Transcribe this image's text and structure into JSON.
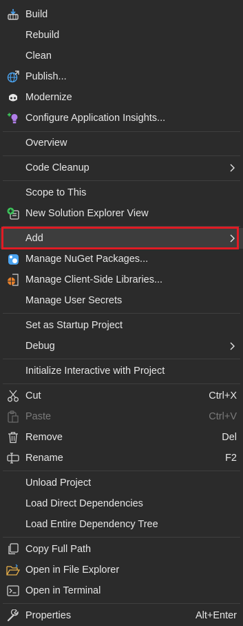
{
  "menu": {
    "items": [
      {
        "label": "Build",
        "icon": "build-icon"
      },
      {
        "label": "Rebuild"
      },
      {
        "label": "Clean"
      },
      {
        "label": "Publish...",
        "icon": "publish-globe-icon"
      },
      {
        "label": "Modernize",
        "icon": "copilot-icon"
      },
      {
        "label": "Configure Application Insights...",
        "icon": "app-insights-icon"
      },
      {
        "label": "Overview"
      },
      {
        "label": "Code Cleanup",
        "submenu": true
      },
      {
        "label": "Scope to This"
      },
      {
        "label": "New Solution Explorer View",
        "icon": "new-view-icon"
      },
      {
        "label": "Add",
        "submenu": true,
        "highlighted": true
      },
      {
        "label": "Manage NuGet Packages...",
        "icon": "nuget-icon"
      },
      {
        "label": "Manage Client-Side Libraries...",
        "icon": "libman-icon"
      },
      {
        "label": "Manage User Secrets"
      },
      {
        "label": "Set as Startup Project"
      },
      {
        "label": "Debug",
        "submenu": true
      },
      {
        "label": "Initialize Interactive with Project"
      },
      {
        "label": "Cut",
        "shortcut": "Ctrl+X",
        "icon": "scissors-icon"
      },
      {
        "label": "Paste",
        "shortcut": "Ctrl+V",
        "icon": "clipboard-icon",
        "disabled": true
      },
      {
        "label": "Remove",
        "shortcut": "Del",
        "icon": "trash-icon"
      },
      {
        "label": "Rename",
        "shortcut": "F2",
        "icon": "rename-icon"
      },
      {
        "label": "Unload Project"
      },
      {
        "label": "Load Direct Dependencies"
      },
      {
        "label": "Load Entire Dependency Tree"
      },
      {
        "label": "Copy Full Path",
        "icon": "copy-icon"
      },
      {
        "label": "Open in File Explorer",
        "icon": "folder-open-icon"
      },
      {
        "label": "Open in Terminal",
        "icon": "terminal-icon"
      },
      {
        "label": "Properties",
        "shortcut": "Alt+Enter",
        "icon": "wrench-icon"
      }
    ]
  },
  "colors": {
    "background": "#2b2b2b",
    "highlight": "#3d3d3d",
    "focus_border": "#e01b24",
    "text": "#e6e6e6",
    "disabled_text": "#7a7a7a"
  }
}
